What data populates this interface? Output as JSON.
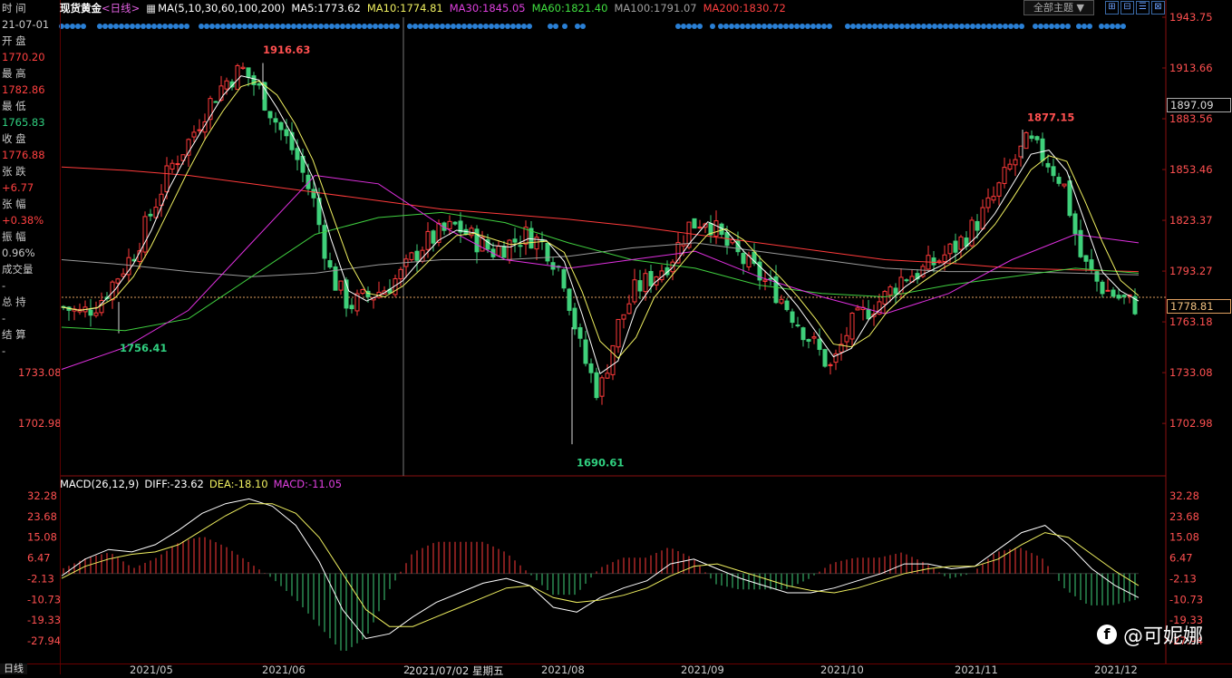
{
  "info_panel": {
    "rows": [
      {
        "text": "时 间",
        "cls": "lbl"
      },
      {
        "text": "21-07-01",
        "cls": "lbl"
      },
      {
        "text": "开 盘",
        "cls": "lbl"
      },
      {
        "text": "1770.20",
        "cls": "red"
      },
      {
        "text": "最 高",
        "cls": "lbl"
      },
      {
        "text": "1782.86",
        "cls": "red"
      },
      {
        "text": "最 低",
        "cls": "lbl"
      },
      {
        "text": "1765.83",
        "cls": "grn"
      },
      {
        "text": "收 盘",
        "cls": "lbl"
      },
      {
        "text": "1776.88",
        "cls": "red"
      },
      {
        "text": "张 跌",
        "cls": "lbl"
      },
      {
        "text": "+6.77",
        "cls": "red"
      },
      {
        "text": "张 幅",
        "cls": "lbl"
      },
      {
        "text": "+0.38%",
        "cls": "red"
      },
      {
        "text": "振 幅",
        "cls": "lbl"
      },
      {
        "text": "0.96%",
        "cls": "lbl"
      },
      {
        "text": "成交量",
        "cls": "lbl"
      },
      {
        "text": "-",
        "cls": "lbl"
      },
      {
        "text": "总 持",
        "cls": "lbl"
      },
      {
        "text": "-",
        "cls": "lbl"
      },
      {
        "text": "结 算",
        "cls": "lbl"
      },
      {
        "text": "-",
        "cls": "lbl"
      }
    ]
  },
  "header": {
    "title": "现货黄金",
    "period": "<日线>",
    "ma_label": "MA(5,10,30,60,100,200)",
    "ma": [
      {
        "text": "MA5:1773.62",
        "color": "#ffffff"
      },
      {
        "text": "MA10:1774.81",
        "color": "#f0f060"
      },
      {
        "text": "MA30:1845.05",
        "color": "#e040e0"
      },
      {
        "text": "MA60:1821.40",
        "color": "#40e040"
      },
      {
        "text": "MA100:1791.07",
        "color": "#a0a0a0"
      },
      {
        "text": "MA200:1830.72",
        "color": "#ff4040"
      }
    ],
    "theme_button": "全部主题",
    "theme_arrow": "▼"
  },
  "macd_header": {
    "label": "MACD(26,12,9)",
    "diff": "DIFF:-23.62",
    "dea": "DEA:-18.10",
    "macd": "MACD:-11.05"
  },
  "price_axis": {
    "left_ticks": [
      "1733.08",
      "1702.98"
    ],
    "current_price": "1778.81",
    "top_box": "1897.09"
  },
  "bottom": {
    "day_tag": "日线",
    "crosshair_date": "2021/07/02 星期五",
    "crosshair_prefix": "2"
  },
  "watermark": {
    "text": "@可妮娜",
    "logo": "f-logo-icon"
  },
  "colors": {
    "up": "#ff3a3a",
    "down": "#3fd07a",
    "axis_red": "#8a1010",
    "bg": "#000000"
  },
  "chart_data": [
    {
      "type": "candlestick",
      "title": "现货黄金 日线",
      "y_ticks": [
        1943.75,
        1913.66,
        1883.56,
        1853.46,
        1823.37,
        1793.27,
        1763.18,
        1733.08,
        1702.98
      ],
      "ylim": [
        1682,
        1950
      ],
      "x_ticks": [
        "2021/05",
        "2021/06",
        "2021/08",
        "2021/09",
        "2021/10",
        "2021/11",
        "2021/12"
      ],
      "annotations": [
        {
          "text": "1916.63",
          "kind": "high"
        },
        {
          "text": "1756.41",
          "kind": "low"
        },
        {
          "text": "1690.61",
          "kind": "low"
        },
        {
          "text": "1877.15",
          "kind": "high"
        }
      ],
      "close_path": [
        1772,
        1768,
        1775,
        1790,
        1805,
        1830,
        1855,
        1870,
        1890,
        1905,
        1913,
        1900,
        1880,
        1862,
        1835,
        1790,
        1773,
        1778,
        1783,
        1792,
        1808,
        1815,
        1820,
        1812,
        1805,
        1810,
        1815,
        1808,
        1790,
        1745,
        1720,
        1760,
        1782,
        1790,
        1800,
        1820,
        1825,
        1810,
        1800,
        1790,
        1780,
        1765,
        1750,
        1735,
        1760,
        1770,
        1778,
        1790,
        1793,
        1800,
        1808,
        1820,
        1835,
        1855,
        1870,
        1860,
        1845,
        1800,
        1785,
        1778,
        1773
      ],
      "ma_lines": [
        {
          "name": "MA200",
          "color": "#ff3b3b",
          "values": [
            1855,
            1853,
            1850,
            1845,
            1840,
            1835,
            1830,
            1827,
            1824,
            1820,
            1815,
            1810,
            1805,
            1800,
            1798,
            1795,
            1794,
            1793
          ]
        },
        {
          "name": "MA100",
          "color": "#9a9a9a",
          "values": [
            1800,
            1797,
            1793,
            1790,
            1792,
            1797,
            1800,
            1800,
            1802,
            1807,
            1810,
            1805,
            1800,
            1795,
            1793,
            1793,
            1792,
            1791
          ]
        },
        {
          "name": "MA60",
          "color": "#40d040",
          "values": [
            1760,
            1758,
            1765,
            1790,
            1815,
            1825,
            1828,
            1822,
            1810,
            1800,
            1795,
            1785,
            1780,
            1778,
            1785,
            1790,
            1795,
            1792
          ]
        },
        {
          "name": "MA30",
          "color": "#e030e0",
          "values": [
            1735,
            1748,
            1770,
            1810,
            1850,
            1845,
            1820,
            1800,
            1795,
            1800,
            1805,
            1790,
            1778,
            1768,
            1780,
            1800,
            1815,
            1810
          ]
        }
      ]
    },
    {
      "type": "line+bar",
      "title": "MACD(26,12,9)",
      "y_ticks": [
        32.28,
        23.68,
        15.08,
        6.47,
        -2.13,
        -10.73,
        -19.33,
        -27.94
      ],
      "ylim": [
        -34,
        36
      ],
      "series": [
        {
          "name": "DIFF",
          "color": "#ffffff",
          "values": [
            -1,
            6,
            10,
            9,
            12,
            18,
            25,
            29,
            31,
            28,
            20,
            5,
            -15,
            -27,
            -25,
            -18,
            -12,
            -8,
            -4,
            -2,
            -5,
            -14,
            -16,
            -10,
            -6,
            -3,
            4,
            6,
            2,
            -2,
            -5,
            -8,
            -8,
            -6,
            -3,
            0,
            4,
            4,
            2,
            3,
            10,
            17,
            20,
            12,
            2,
            -5,
            -10
          ]
        },
        {
          "name": "DEA",
          "color": "#f0f060",
          "values": [
            -2,
            3,
            6,
            8,
            9,
            12,
            18,
            24,
            29,
            29,
            25,
            15,
            0,
            -15,
            -22,
            -22,
            -18,
            -14,
            -10,
            -6,
            -5,
            -10,
            -12,
            -11,
            -9,
            -6,
            -1,
            3,
            4,
            1,
            -2,
            -5,
            -7,
            -8,
            -6,
            -3,
            0,
            2,
            3,
            3,
            6,
            12,
            17,
            15,
            8,
            1,
            -5
          ]
        }
      ]
    }
  ]
}
